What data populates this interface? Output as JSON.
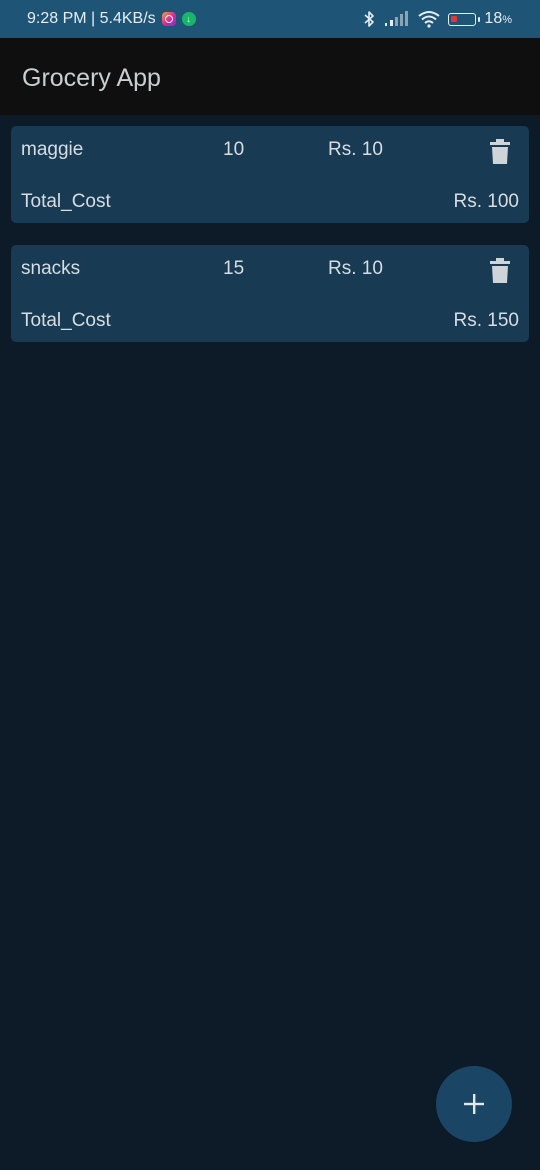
{
  "status_bar": {
    "time_speed": "9:28 PM | 5.4KB/s",
    "battery_percent": "18",
    "battery_percent_suffix": "%",
    "icons": [
      "instagram-icon",
      "download-icon",
      "bluetooth-icon",
      "signal-icon",
      "wifi-icon",
      "battery-icon"
    ]
  },
  "app_bar": {
    "title": "Grocery App"
  },
  "items": [
    {
      "name": "maggie",
      "quantity": "10",
      "price": "Rs. 10",
      "total_label": "Total_Cost",
      "total_value": "Rs. 100"
    },
    {
      "name": "snacks",
      "quantity": "15",
      "price": "Rs. 10",
      "total_label": "Total_Cost",
      "total_value": "Rs. 150"
    }
  ],
  "colors": {
    "status_bar": "#1e5577",
    "app_bar": "#0f0f10",
    "background": "#0c1b27",
    "card": "#183a52",
    "fab": "#1b4565"
  }
}
